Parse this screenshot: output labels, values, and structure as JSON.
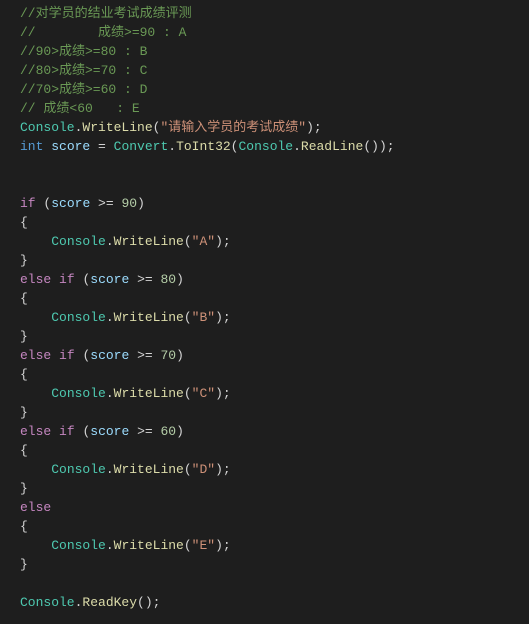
{
  "code": {
    "c1": "//对学员的结业考试成绩评测",
    "c2": "//        成绩>=90 : A",
    "c3": "//90>成绩>=80 : B",
    "c4": "//80>成绩>=70 : C",
    "c5": "//70>成绩>=60 : D",
    "c6": "// 成绩<60   : E",
    "console": "Console",
    "writeLine": "WriteLine",
    "readLine": "ReadLine",
    "readKey": "ReadKey",
    "convert": "Convert",
    "toInt32": "ToInt32",
    "promptStr": "\"请输入学员的考试成绩\"",
    "strA": "\"A\"",
    "strB": "\"B\"",
    "strC": "\"C\"",
    "strD": "\"D\"",
    "strE": "\"E\"",
    "kwInt": "int",
    "kwIf": "if",
    "kwElse": "else",
    "varScore": "score",
    "n90": "90",
    "n80": "80",
    "n70": "70",
    "n60": "60",
    "opBrace": "{",
    "clBrace": "}",
    "dot": ".",
    "opParen": "(",
    "clParen": ")",
    "semi": ";",
    "space": " ",
    "assign": " = ",
    "gte": " >= ",
    "clParenSemi": ");",
    "clParen2Semi": "));",
    "clParen2": "()"
  }
}
